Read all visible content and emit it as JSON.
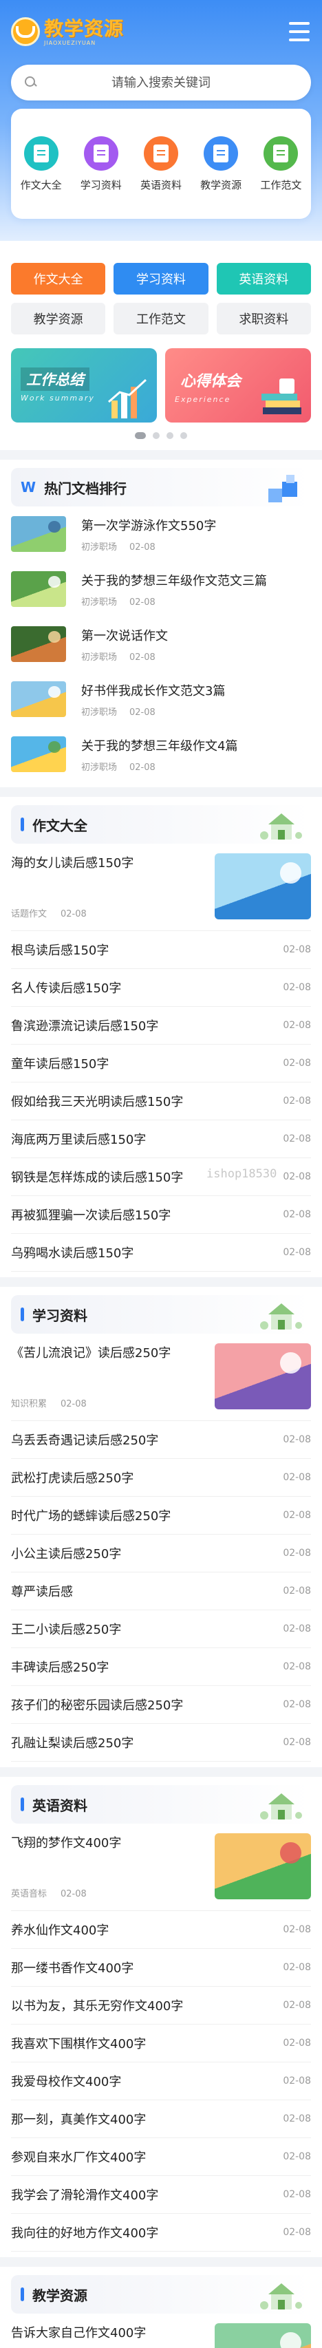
{
  "header": {
    "logo_title": "教学资源",
    "logo_subtitle": "JIAOXUEZIYUAN",
    "search_placeholder": "请输入搜索关键词"
  },
  "categories": [
    {
      "label": "作文大全",
      "icon": "book-icon",
      "color": "#1fc1c3"
    },
    {
      "label": "学习资料",
      "icon": "document-icon",
      "color": "#a35af0"
    },
    {
      "label": "英语资料",
      "icon": "document-icon",
      "color": "#fb7632"
    },
    {
      "label": "教学资源",
      "icon": "clipboard-icon",
      "color": "#3d8df5"
    },
    {
      "label": "工作范文",
      "icon": "file-icon",
      "color": "#54b84c"
    }
  ],
  "tags": [
    {
      "label": "作文大全",
      "bg": "#fb7a2c",
      "fg": "#ffffff"
    },
    {
      "label": "学习资料",
      "bg": "#2f8cf2",
      "fg": "#ffffff"
    },
    {
      "label": "英语资料",
      "bg": "#1fc6b4",
      "fg": "#ffffff"
    },
    {
      "label": "教学资源",
      "bg": "#f1f2f4",
      "fg": "#333333"
    },
    {
      "label": "工作范文",
      "bg": "#f1f2f4",
      "fg": "#333333"
    },
    {
      "label": "求职资料",
      "bg": "#f1f2f4",
      "fg": "#333333"
    }
  ],
  "banners": [
    {
      "title": "工作总结",
      "subtitle": "Work summary"
    },
    {
      "title": "心得体会",
      "subtitle": "Experience"
    }
  ],
  "ranking": {
    "title": "热门文档排行",
    "items": [
      {
        "title": "第一次学游泳作文550字",
        "source": "初涉职场",
        "date": "02-08"
      },
      {
        "title": "关于我的梦想三年级作文范文三篇",
        "source": "初涉职场",
        "date": "02-08"
      },
      {
        "title": "第一次说话作文",
        "source": "初涉职场",
        "date": "02-08"
      },
      {
        "title": "好书伴我成长作文范文3篇",
        "source": "初涉职场",
        "date": "02-08"
      },
      {
        "title": "关于我的梦想三年级作文4篇",
        "source": "初涉职场",
        "date": "02-08"
      }
    ]
  },
  "sections": [
    {
      "title": "作文大全",
      "featured": {
        "title": "海的女儿读后感150字",
        "source": "话题作文",
        "date": "02-08"
      },
      "items": [
        {
          "title": "根鸟读后感150字",
          "date": "02-08"
        },
        {
          "title": "名人传读后感150字",
          "date": "02-08"
        },
        {
          "title": "鲁滨逊漂流记读后感150字",
          "date": "02-08"
        },
        {
          "title": "童年读后感150字",
          "date": "02-08"
        },
        {
          "title": "假如给我三天光明读后感150字",
          "date": "02-08"
        },
        {
          "title": "海底两万里读后感150字",
          "date": "02-08"
        },
        {
          "title": "钢铁是怎样炼成的读后感150字",
          "date": "02-08"
        },
        {
          "title": "再被狐狸骗一次读后感150字",
          "date": "02-08"
        },
        {
          "title": "乌鸦喝水读后感150字",
          "date": "02-08"
        }
      ]
    },
    {
      "title": "学习资料",
      "featured": {
        "title": "《苦儿流浪记》读后感250字",
        "source": "知识积累",
        "date": "02-08"
      },
      "items": [
        {
          "title": "乌丢丢奇遇记读后感250字",
          "date": "02-08"
        },
        {
          "title": "武松打虎读后感250字",
          "date": "02-08"
        },
        {
          "title": "时代广场的蟋蟀读后感250字",
          "date": "02-08"
        },
        {
          "title": "小公主读后感250字",
          "date": "02-08"
        },
        {
          "title": "尊严读后感",
          "date": "02-08"
        },
        {
          "title": "王二小读后感250字",
          "date": "02-08"
        },
        {
          "title": "丰碑读后感250字",
          "date": "02-08"
        },
        {
          "title": "孩子们的秘密乐园读后感250字",
          "date": "02-08"
        },
        {
          "title": "孔融让梨读后感250字",
          "date": "02-08"
        }
      ]
    },
    {
      "title": "英语资料",
      "featured": {
        "title": "飞翔的梦作文400字",
        "source": "英语音标",
        "date": "02-08"
      },
      "items": [
        {
          "title": "养水仙作文400字",
          "date": "02-08"
        },
        {
          "title": "那一缕书香作文400字",
          "date": "02-08"
        },
        {
          "title": "以书为友，其乐无穷作文400字",
          "date": "02-08"
        },
        {
          "title": "我喜欢下围棋作文400字",
          "date": "02-08"
        },
        {
          "title": "我爱母校作文400字",
          "date": "02-08"
        },
        {
          "title": "那一刻，真美作文400字",
          "date": "02-08"
        },
        {
          "title": "参观自来水厂作文400字",
          "date": "02-08"
        },
        {
          "title": "我学会了滑轮滑作文400字",
          "date": "02-08"
        },
        {
          "title": "我向往的好地方作文400字",
          "date": "02-08"
        }
      ]
    },
    {
      "title": "教学资源",
      "featured": {
        "title": "告诉大家自己作文400字",
        "source": "",
        "date": ""
      },
      "items": []
    }
  ],
  "watermark": "ishop18530"
}
